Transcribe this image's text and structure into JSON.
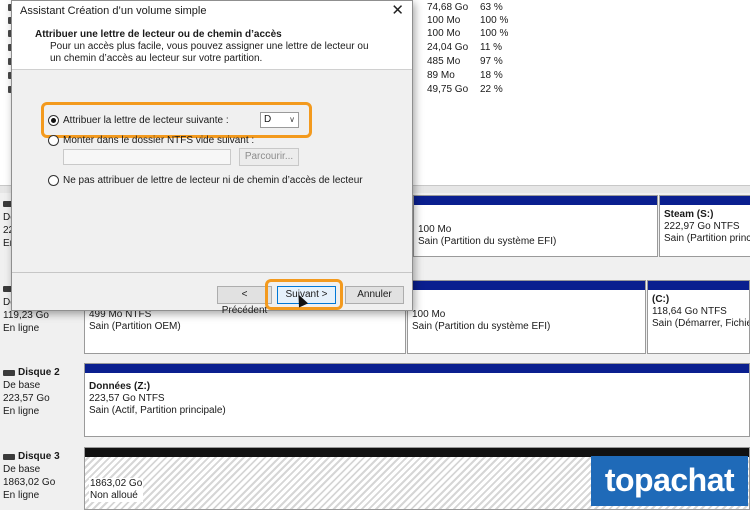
{
  "volume_list": {
    "rows": [
      {
        "capacity": "74,68 Go",
        "pct": "63 %"
      },
      {
        "capacity": "100 Mo",
        "pct": "100 %"
      },
      {
        "capacity": "100 Mo",
        "pct": "100 %"
      },
      {
        "capacity": "24,04 Go",
        "pct": "11 %"
      },
      {
        "capacity": "485 Mo",
        "pct": "97 %"
      },
      {
        "capacity": "89 Mo",
        "pct": "18 %"
      },
      {
        "capacity": "49,75 Go",
        "pct": "22 %"
      }
    ]
  },
  "disks": {
    "d0": {
      "label_lines": [
        "De",
        "222",
        "En"
      ],
      "partitions": [
        {
          "size": "100 Mo",
          "status": "Sain (Partition du système EFI)"
        },
        {
          "name": "Steam  (S:)",
          "size": "222,97 Go NTFS",
          "status": "Sain (Partition princ"
        }
      ]
    },
    "d1": {
      "label_lines": [
        "De",
        "119,23 Go",
        "En ligne"
      ],
      "partitions": [
        {
          "size": "499 Mo NTFS",
          "status": "Sain (Partition OEM)"
        },
        {
          "size": "100 Mo",
          "status": "Sain (Partition du système EFI)"
        },
        {
          "name": "(C:)",
          "size": "118,64 Go NTFS",
          "status": "Sain (Démarrer, Fichier"
        }
      ]
    },
    "d2": {
      "name": "Disque 2",
      "type": "De base",
      "size": "223,57 Go",
      "state": "En ligne",
      "partition": {
        "name": "Données  (Z:)",
        "size": "223,57 Go NTFS",
        "status": "Sain (Actif, Partition principale)"
      }
    },
    "d3": {
      "name": "Disque 3",
      "type": "De base",
      "size": "1863,02 Go",
      "state": "En ligne",
      "partition": {
        "size": "1863,02 Go",
        "status": "Non alloué"
      }
    }
  },
  "dialog": {
    "title": "Assistant Création d’un volume simple",
    "close_glyph": "✕",
    "heading": "Attribuer une lettre de lecteur ou de chemin d’accès",
    "description": "Pour un accès plus facile, vous pouvez assigner une lettre de lecteur ou un chemin d’accès au lecteur sur votre partition.",
    "options": {
      "assign_letter": "Attribuer la lettre de lecteur suivante :",
      "mount_folder": "Monter dans le dossier NTFS vide suivant :",
      "no_assign": "Ne pas attribuer de lettre de lecteur ni de chemin d’accès de lecteur"
    },
    "selected_letter": "D",
    "browse_label": "Parcourir...",
    "back_label": "< Précédent",
    "next_label": "Suivant >",
    "cancel_label": "Annuler"
  },
  "logo": {
    "text": "topachat"
  },
  "colors": {
    "highlight": "#f39a1e",
    "partition_bar": "#0a1f8f",
    "logo_bg": "#1f6ab8"
  }
}
